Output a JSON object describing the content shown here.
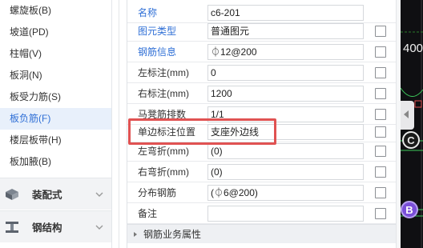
{
  "sidebar": {
    "items": [
      {
        "label": "螺旋板(B)"
      },
      {
        "label": "坡道(PD)"
      },
      {
        "label": "柱帽(V)"
      },
      {
        "label": "板洞(N)"
      },
      {
        "label": "板受力筋(S)"
      },
      {
        "label": "板负筋(F)",
        "active": true
      },
      {
        "label": "楼层板带(H)"
      },
      {
        "label": "板加腋(B)"
      }
    ],
    "groups": [
      {
        "label": "装配式",
        "icon": "prefab-icon"
      },
      {
        "label": "钢结构",
        "icon": "steel-beam-icon"
      }
    ]
  },
  "properties": {
    "rows": [
      {
        "label": "名称",
        "value": "c6-201",
        "link": true,
        "checkbox": false
      },
      {
        "label": "图元类型",
        "value": "普通图元",
        "link": true,
        "checkbox": true
      },
      {
        "label": "钢筋信息",
        "value": "⏀12@200",
        "link": true,
        "checkbox": true
      },
      {
        "label": "左标注(mm)",
        "value": "0",
        "link": false,
        "checkbox": true
      },
      {
        "label": "右标注(mm)",
        "value": "1200",
        "link": false,
        "checkbox": true
      },
      {
        "label": "马凳筋排数",
        "value": "1/1",
        "link": false,
        "checkbox": true
      },
      {
        "label": "单边标注位置",
        "value": "支座外边线",
        "link": false,
        "checkbox": true
      },
      {
        "label": "左弯折(mm)",
        "value": "(0)",
        "link": false,
        "checkbox": true
      },
      {
        "label": "右弯折(mm)",
        "value": "(0)",
        "link": false,
        "checkbox": true
      },
      {
        "label": "分布钢筋",
        "value": "(⏀6@200)",
        "link": false,
        "checkbox": true
      },
      {
        "label": "备注",
        "value": "",
        "link": false,
        "checkbox": true
      }
    ],
    "section": {
      "label": "钢筋业务属性"
    }
  },
  "cad_view": {
    "number_text": "400",
    "axis_c": "C",
    "axis_b": "B"
  },
  "colors": {
    "accent": "#2f6fd6",
    "highlight": "#e05252",
    "cad_background": "#0f0f12"
  }
}
